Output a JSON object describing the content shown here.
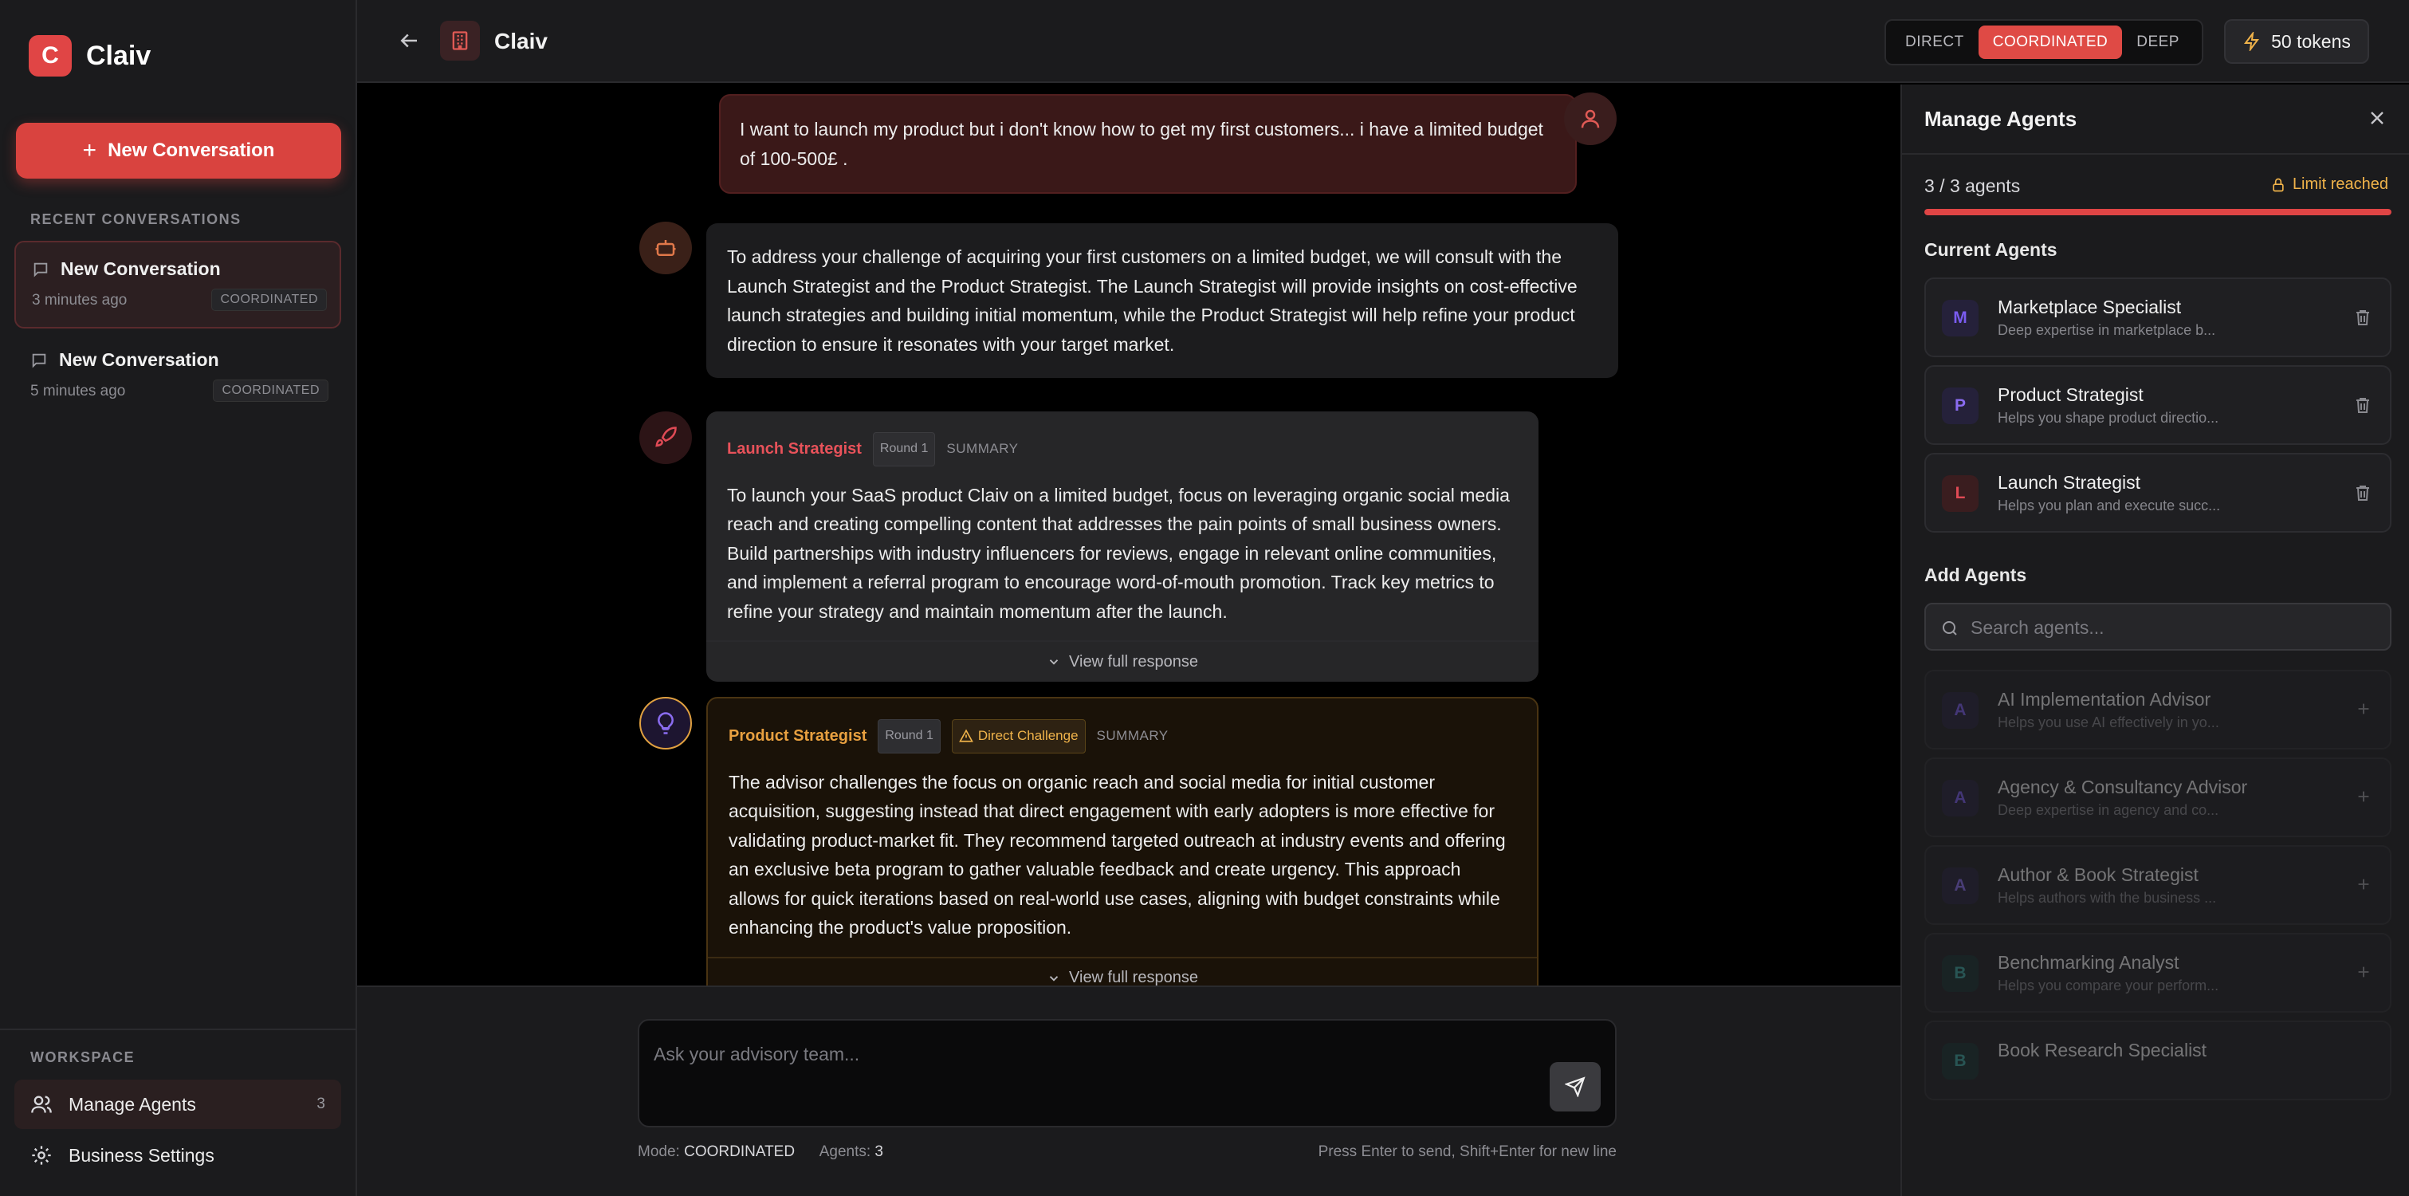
{
  "app": {
    "name": "Claiv",
    "logo_letter": "C"
  },
  "sidebar": {
    "new_conversation_label": "New Conversation",
    "recent_label": "RECENT CONVERSATIONS",
    "conversations": [
      {
        "title": "New Conversation",
        "time": "3 minutes ago",
        "mode": "COORDINATED"
      },
      {
        "title": "New Conversation",
        "time": "5 minutes ago",
        "mode": "COORDINATED"
      }
    ],
    "workspace_label": "WORKSPACE",
    "workspace_items": [
      {
        "label": "Manage Agents",
        "count": "3"
      },
      {
        "label": "Business Settings"
      }
    ]
  },
  "header": {
    "title": "Claiv",
    "modes": [
      "DIRECT",
      "COORDINATED",
      "DEEP"
    ],
    "active_mode": "COORDINATED",
    "tokens": "50 tokens"
  },
  "chat": {
    "user_message": "I want to launch my product but i don't know how to get my first customers... i have a limited budget of 100-500£ .",
    "system_message": "To address your challenge of acquiring your first customers on a limited budget, we will consult with the Launch Strategist and the Product Strategist. The Launch Strategist will provide insights on cost-effective launch strategies and building initial momentum, while the Product Strategist will help refine your product direction to ensure it resonates with your target market.",
    "responses": [
      {
        "agent": "Launch Strategist",
        "round": "Round 1",
        "summary_label": "SUMMARY",
        "text": "To launch your SaaS product Claiv on a limited budget, focus on leveraging organic social media reach and creating compelling content that addresses the pain points of small business owners. Build partnerships with industry influencers for reviews, engage in relevant online communities, and implement a referral program to encourage word-of-mouth promotion. Track key metrics to refine your strategy and maintain momentum after the launch.",
        "view_full": "View full response"
      },
      {
        "agent": "Product Strategist",
        "round": "Round 1",
        "challenge": "Direct Challenge",
        "summary_label": "SUMMARY",
        "text": "The advisor challenges the focus on organic reach and social media for initial customer acquisition, suggesting instead that direct engagement with early adopters is more effective for validating product-market fit. They recommend targeted outreach at industry events and offering an exclusive beta program to gather valuable feedback and create urgency. This approach allows for quick iterations based on real-world use cases, aligning with budget constraints while enhancing the product's value proposition.",
        "view_full": "View full response"
      }
    ]
  },
  "composer": {
    "placeholder": "Ask your advisory team...",
    "mode_label": "Mode:",
    "mode_value": "COORDINATED",
    "agents_label": "Agents:",
    "agents_value": "3",
    "hint": "Press Enter to send, Shift+Enter for new line"
  },
  "panel": {
    "title": "Manage Agents",
    "agent_count": "3 / 3 agents",
    "limit_text": "Limit reached",
    "limit_fraction": 1.0,
    "current_label": "Current Agents",
    "current_agents": [
      {
        "initial": "M",
        "name": "Marketplace Specialist",
        "desc": "Deep expertise in marketplace b..."
      },
      {
        "initial": "P",
        "name": "Product Strategist",
        "desc": "Helps you shape product directio..."
      },
      {
        "initial": "L",
        "name": "Launch Strategist",
        "desc": "Helps you plan and execute succ..."
      }
    ],
    "add_label": "Add Agents",
    "search_placeholder": "Search agents...",
    "available_agents": [
      {
        "initial": "A",
        "name": "AI Implementation Advisor",
        "desc": "Helps you use AI effectively in yo..."
      },
      {
        "initial": "A",
        "name": "Agency & Consultancy Advisor",
        "desc": "Deep expertise in agency and co..."
      },
      {
        "initial": "A",
        "name": "Author & Book Strategist",
        "desc": "Helps authors with the business ..."
      },
      {
        "initial": "B",
        "name": "Benchmarking Analyst",
        "desc": "Helps you compare your perform..."
      },
      {
        "initial": "B",
        "name": "Book Research Specialist",
        "desc": ""
      }
    ]
  },
  "colors": {
    "accent": "#e04545",
    "warning": "#f0b34a",
    "purple": "#7a5cf0"
  }
}
